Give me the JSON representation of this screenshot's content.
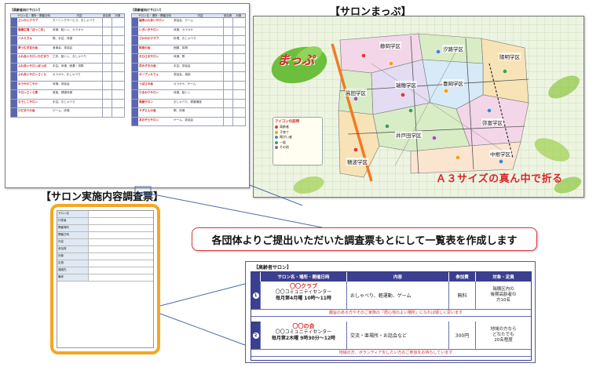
{
  "brochure": {
    "left_header": "【高齢者向けサロン】",
    "right_header": "【高齢者向けサロン】",
    "table_head": [
      "サロン名・場所・開催日時",
      "内容",
      "参加費",
      "対象"
    ],
    "left_rows": [
      {
        "name": "さいかいクラブ",
        "content": "モーニングサービス、おしゃべり"
      },
      {
        "name": "健康広場「ぼっこ村」",
        "content": "体操、脳トレ、カラオケ"
      },
      {
        "name": "ハナミズキ",
        "content": "歌、手芸、体操"
      },
      {
        "name": "夢つむぎ友の会",
        "content": "食事会、茶話会"
      },
      {
        "name": "ふれあいサロンひだまり",
        "content": "工作、脳トレ、おしゃべり"
      },
      {
        "name": "ふれあいサロンぽっぽ",
        "content": "手芸、体操、囲碁・将棋"
      },
      {
        "name": "ふれあいサロンさくら",
        "content": "カラオケ、おしゃべり"
      },
      {
        "name": "ゆうやけこやけ",
        "content": "体操、茶話会"
      },
      {
        "name": "サロンさくら草",
        "content": "音楽、健康体操"
      },
      {
        "name": "なでしこサロン",
        "content": "手芸、おしゃべり"
      },
      {
        "name": "ひだまりの会",
        "content": "ゲーム、体操"
      }
    ],
    "right_rows": [
      {
        "name": "福寿ふれあいサロン",
        "content": "茶話会、ゲーム"
      },
      {
        "name": "いきいきサロン",
        "content": "体操、カラオケ"
      },
      {
        "name": "さわやかクラブ",
        "content": "料理、おしゃべり"
      },
      {
        "name": "和楽の会",
        "content": "囲碁、将棋"
      },
      {
        "name": "おひさまサロン",
        "content": "体操、歌"
      },
      {
        "name": "花みずきの会",
        "content": "手芸、茶話会"
      },
      {
        "name": "オープンカフェ",
        "content": "茶話会、相談"
      },
      {
        "name": "つばさの会",
        "content": "カラオケ、ゲーム"
      },
      {
        "name": "ひまわりサロン",
        "content": "体操、脳トレ"
      },
      {
        "name": "笑顔サロン",
        "content": "おしゃべり、健康講座"
      },
      {
        "name": "すずらんの会",
        "content": "歌、体操"
      },
      {
        "name": "あおぞらサロン",
        "content": "ゲーム、茶話会"
      }
    ]
  },
  "map": {
    "title": "【サロンまっぷ】",
    "logo_text": "まっぷ",
    "a3_note": "Ａ３サイズの真ん中で折る",
    "districts": [
      {
        "name": "静岡学区"
      },
      {
        "name": "汐路学区"
      },
      {
        "name": "陽明学区"
      },
      {
        "name": "高田学区"
      },
      {
        "name": "瑞穂学区"
      },
      {
        "name": "豊岡学区"
      },
      {
        "name": "弥富学区"
      },
      {
        "name": "井戸田学区"
      },
      {
        "name": "穂波学区"
      },
      {
        "name": "中根学区"
      }
    ],
    "legend_title": "アイコンの説明",
    "legend": [
      {
        "label": "高齢者",
        "color": "#e23b3b"
      },
      {
        "label": "子育て",
        "color": "#f0a020"
      },
      {
        "label": "障がい者",
        "color": "#3c8ad8"
      },
      {
        "label": "一般",
        "color": "#37a84b"
      },
      {
        "label": "その他",
        "color": "#9b59b6"
      }
    ]
  },
  "survey": {
    "title": "【サロン実施内容調査票】",
    "rows": [
      {
        "key": "サロン名",
        "value": ""
      },
      {
        "key": "代表者",
        "value": ""
      },
      {
        "key": "開催場所",
        "value": ""
      },
      {
        "key": "開催日時",
        "value": ""
      },
      {
        "key": "内容",
        "value": ""
      },
      {
        "key": "参加費",
        "value": ""
      },
      {
        "key": "対象",
        "value": ""
      },
      {
        "key": "定員",
        "value": ""
      },
      {
        "key": "連絡先",
        "value": ""
      },
      {
        "key": "備考",
        "value": ""
      }
    ]
  },
  "callout": {
    "text": "各団体よりご提出いただいた調査票もとにして一覧表を作成します"
  },
  "zoom": {
    "title": "【高齢者サロン】",
    "headers": [
      "サロン名・場所・開催日時",
      "内容",
      "参加費",
      "対象・定員"
    ],
    "entries": [
      {
        "num": "1",
        "name": "〇〇クラブ",
        "place": "〇〇コミュニティセンター",
        "schedule": "毎月第4月曜 10時～11時",
        "content": "おしゃべり、軽運動、ゲーム",
        "fee": "無料",
        "target": "瑞穂区内の\n後期高齢者の\n方10名",
        "message": "趣旨のある方やそのご家族の「居心地のよい場所」になれば嬉しく思います"
      },
      {
        "num": "2",
        "name": "〇〇の会",
        "place": "〇〇コミュニティセンター",
        "schedule": "毎月第2木曜 9時30分～12時",
        "content": "交流・亜場所・お話会など",
        "fee": "300円",
        "target": "地域の方なら\nどなたでも\n20名程度",
        "message": "地域の方、ボランティアをしたい方のご参加をお待ちしています"
      }
    ]
  }
}
